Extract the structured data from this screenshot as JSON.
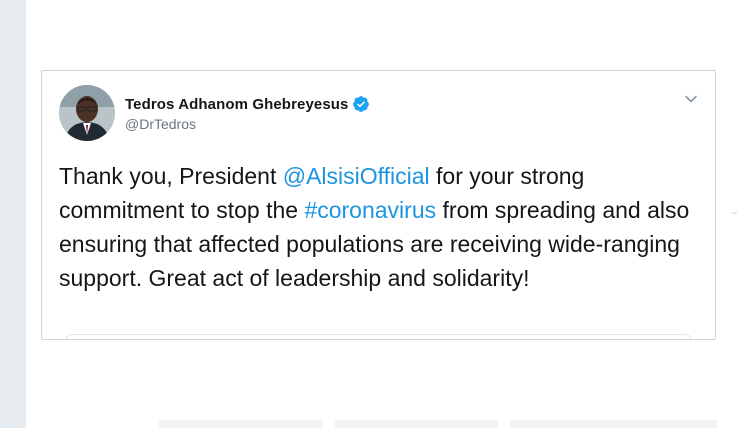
{
  "tweet": {
    "author": {
      "display_name": "Tedros Adhanom Ghebreyesus",
      "handle": "@DrTedros",
      "verified": true
    },
    "text_segments": [
      {
        "type": "text",
        "value": "Thank you, President "
      },
      {
        "type": "mention",
        "value": "@AlsisiOfficial"
      },
      {
        "type": "text",
        "value": " for your strong commitment to stop the "
      },
      {
        "type": "hashtag",
        "value": "#coronavirus"
      },
      {
        "type": "text",
        "value": " from spreading and also ensuring that affected populations are receiving wide-ranging support. Great act of leadership and solidarity!"
      }
    ]
  },
  "icons": {
    "verified": "verified-badge-icon",
    "menu": "chevron-down-icon"
  },
  "colors": {
    "link": "#1b95e0",
    "verified": "#1da1f2",
    "text": "#14171a",
    "muted": "#657786",
    "border": "#ccd6dd",
    "background": "#e6ecf0"
  }
}
